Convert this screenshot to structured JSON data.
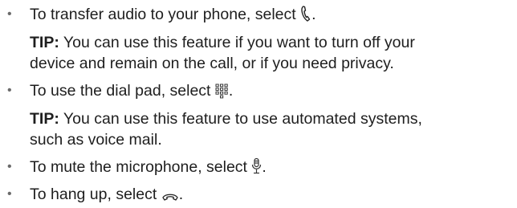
{
  "items": [
    {
      "bullet": "•",
      "text": "To transfer audio to your phone, select",
      "icon": "handset-icon",
      "end": ".",
      "tip": {
        "label": "TIP:",
        "line1": "You can use this feature if you want to turn off your",
        "line2": "device and remain on the call, or if you need privacy."
      }
    },
    {
      "bullet": "•",
      "text": "To use the dial pad, select",
      "icon": "dial-pad-icon",
      "end": ".",
      "tip": {
        "label": "TIP:",
        "line1": "You can use this feature to use automated systems,",
        "line2": "such as voice mail."
      }
    },
    {
      "bullet": "•",
      "text": "To mute the microphone, select",
      "icon": "microphone-icon",
      "end": "."
    },
    {
      "bullet": "•",
      "text": "To hang up, select",
      "icon": "hang-up-icon",
      "end": "."
    }
  ]
}
